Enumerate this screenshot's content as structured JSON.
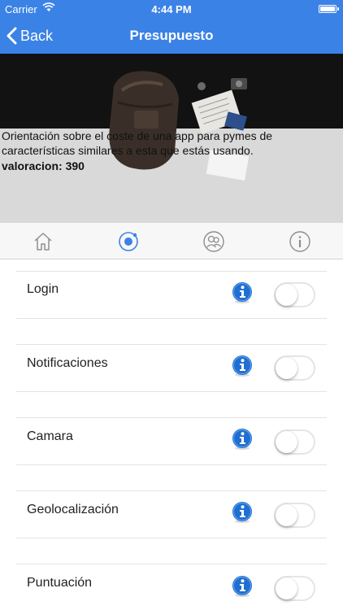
{
  "status_bar": {
    "carrier": "Carrier",
    "time": "4:44 PM"
  },
  "nav": {
    "back_label": "Back",
    "title": "Presupuesto"
  },
  "hero": {
    "description": "Orientación sobre el coste de una app para pymes de características similares a esta que estás usando.",
    "rating_text": "valoracion: 390"
  },
  "tabs": [
    {
      "icon": "home-icon",
      "selected": false
    },
    {
      "icon": "target-icon",
      "selected": true
    },
    {
      "icon": "contacts-icon",
      "selected": false
    },
    {
      "icon": "info-icon",
      "selected": false
    }
  ],
  "features": [
    {
      "label": "Login",
      "enabled": false
    },
    {
      "label": "Notificaciones",
      "enabled": false
    },
    {
      "label": "Camara",
      "enabled": false
    },
    {
      "label": "Geolocalización",
      "enabled": false
    },
    {
      "label": "Puntuación",
      "enabled": false
    }
  ],
  "colors": {
    "nav_blue": "#3b82e6",
    "info_blue": "#1f6fd1",
    "tab_active": "#3b82e6",
    "tab_inactive": "#8e8e93"
  }
}
